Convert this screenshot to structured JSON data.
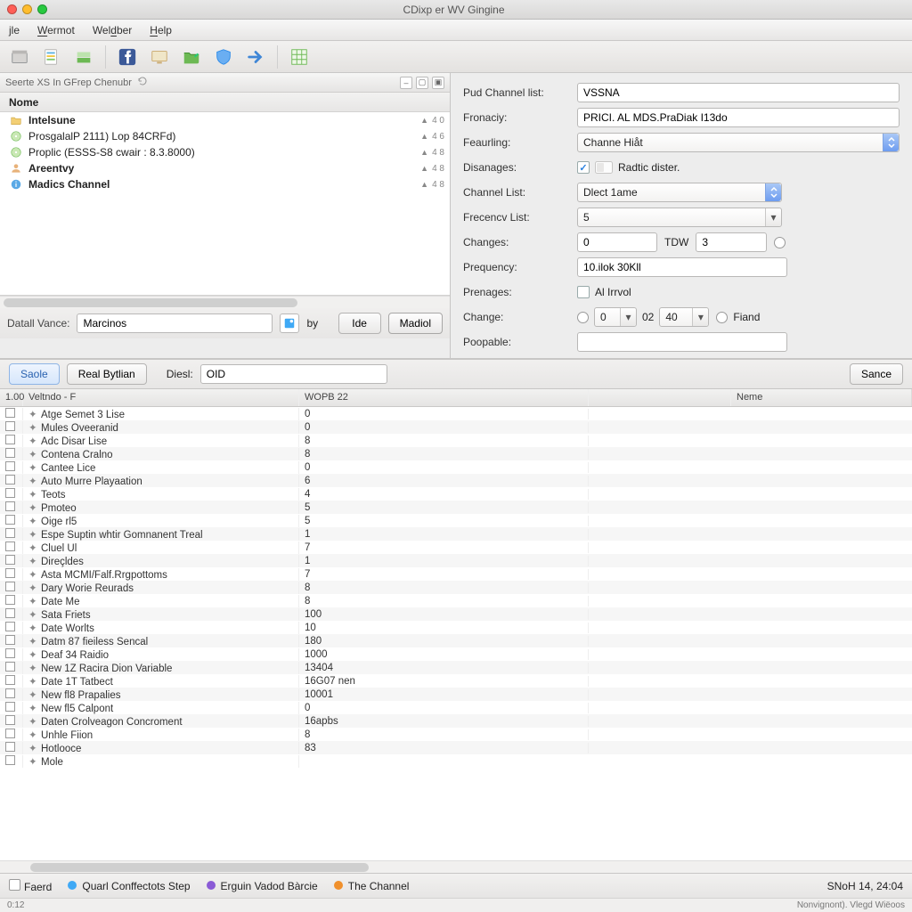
{
  "window": {
    "title": "CDixp er WV Gingine"
  },
  "menu": {
    "file": "jle",
    "wermot": "Wermot",
    "weldber": "Weldber",
    "help": "Help"
  },
  "toolbar": {
    "icons": [
      {
        "name": "box-icon",
        "color": "#8d9092"
      },
      {
        "name": "sheet-icon",
        "color": "#f2c53b"
      },
      {
        "name": "stack-icon",
        "color": "#6db954"
      },
      {
        "name": "facebook-icon",
        "color": "#3b5998"
      },
      {
        "name": "screen-icon",
        "color": "#caa86a"
      },
      {
        "name": "folder-icon",
        "color": "#4caf50"
      },
      {
        "name": "shield-icon",
        "color": "#2e8be8"
      },
      {
        "name": "arrow-right-icon",
        "color": "#3f86d6"
      },
      {
        "name": "grid-icon",
        "color": "#6db954"
      }
    ]
  },
  "leftpanel": {
    "header": "Seerte XS In GFrep Chenubr",
    "column": "Nome",
    "items": [
      {
        "icon": "folder",
        "text": "Intelsune",
        "badge": "4 0",
        "bold": true
      },
      {
        "icon": "disc",
        "text": "ProsgalalP 2111) Lop 84CRFd)",
        "badge": "4 6"
      },
      {
        "icon": "disc",
        "text": "Proplic (ESSS-S8 cwair : 8.3.8000)",
        "badge": "4 8"
      },
      {
        "icon": "user",
        "text": "Areentvy",
        "badge": "4 8",
        "bold": true
      },
      {
        "icon": "info",
        "text": "Madics Channel",
        "badge": "4 8",
        "bold": true
      }
    ],
    "detail_label": "Datall Vance:",
    "detail_value": "Marcinos",
    "by_label": "by",
    "btn_ide": "Ide",
    "btn_mad": "Madiol"
  },
  "form": {
    "pud_label": "Pud Channel list:",
    "pud_value": "VSSNA",
    "fronacy_label": "Fronaciy:",
    "fronacy_value": "PRICI. AL MDS.PraDiak I13do",
    "feaurling_label": "Feaurling:",
    "feaurling_value": "Channe Hiåt",
    "disanages_label": "Disanages:",
    "disanages_checked": true,
    "disanages_text": "Radtic dister.",
    "channel_list_label": "Channel List:",
    "channel_list_value": "Dlect 1ame",
    "freqlist_label": "Frecencv List:",
    "freqlist_value": "5",
    "changes_label": "Changes:",
    "changes_a": "0",
    "changes_mid": "TDW",
    "changes_b": "3",
    "frequency_label": "Prequency:",
    "frequency_value": "10.ilok 30Kll",
    "prenages_label": "Prenages:",
    "prenages_text": "Al Irrvol",
    "change_label": "Change:",
    "change_a": "0",
    "change_mid": "02",
    "change_b": "40",
    "change_end": "Fiand",
    "poopable_label": "Poopable:",
    "poopable_value": ""
  },
  "midbar": {
    "saole": "Saole",
    "real": "Real Bytlian",
    "diesl_label": "Diesl:",
    "diesl_value": "OID",
    "sance": "Sance"
  },
  "table": {
    "headers": {
      "c0": "1.00",
      "c1": "Veltndo - F",
      "c2": "WOPB 22",
      "c3": "",
      "c4": "Neme"
    },
    "rows": [
      {
        "name": "Atge Semet 3 Lise",
        "val": "0"
      },
      {
        "name": "Mules Oveeranid",
        "val": "0"
      },
      {
        "name": "Adc Disar Lise",
        "val": "8"
      },
      {
        "name": "Contena Cralno",
        "val": "8"
      },
      {
        "name": "Cantee Lice",
        "val": "0"
      },
      {
        "name": "Auto Murre Playaation",
        "val": "6"
      },
      {
        "name": "Teots",
        "val": "4"
      },
      {
        "name": "Pmoteo",
        "val": "5"
      },
      {
        "name": "Oige rl5",
        "val": "5"
      },
      {
        "name": "Espe Suptin whtir Gomnanent Treal",
        "val": "1"
      },
      {
        "name": "Cluel Ul",
        "val": "7"
      },
      {
        "name": "Direçldes",
        "val": "1"
      },
      {
        "name": "Asta MCMI/Falf.Rrgpottoms",
        "val": "7"
      },
      {
        "name": "Dary Worie Reurads",
        "val": "8"
      },
      {
        "name": "Date Me",
        "val": "8"
      },
      {
        "name": "Sata Friets",
        "val": "100"
      },
      {
        "name": "Date Worlts",
        "val": "10"
      },
      {
        "name": "Datm 87 fieiless Sencal",
        "val": "180"
      },
      {
        "name": "Deaf 34 Raidio",
        "val": "1000"
      },
      {
        "name": "New 1Z Racira Dion Variable",
        "val": "13404"
      },
      {
        "name": "Date 1T Tatbect",
        "val": "16G07 nen"
      },
      {
        "name": "New fl8 Prapalies",
        "val": "10001"
      },
      {
        "name": "New fl5 Calpont",
        "val": "0"
      },
      {
        "name": "Daten Crolveagon Concroment",
        "val": "16apbs"
      },
      {
        "name": "Unhle Fiion",
        "val": "8"
      },
      {
        "name": "Hotlooce",
        "val": "83"
      },
      {
        "name": "Mole",
        "val": ""
      }
    ]
  },
  "status": {
    "faerd": "Faerd",
    "quarl": "Quarl Conffectots Step",
    "erguin": "Erguin Vadod Bàrcie",
    "channel": "The Channel",
    "right": "SNoH 14, 24:04"
  },
  "footer": {
    "left": "0:12",
    "right": "Nonvignont). Vlegd Wiëoos"
  }
}
